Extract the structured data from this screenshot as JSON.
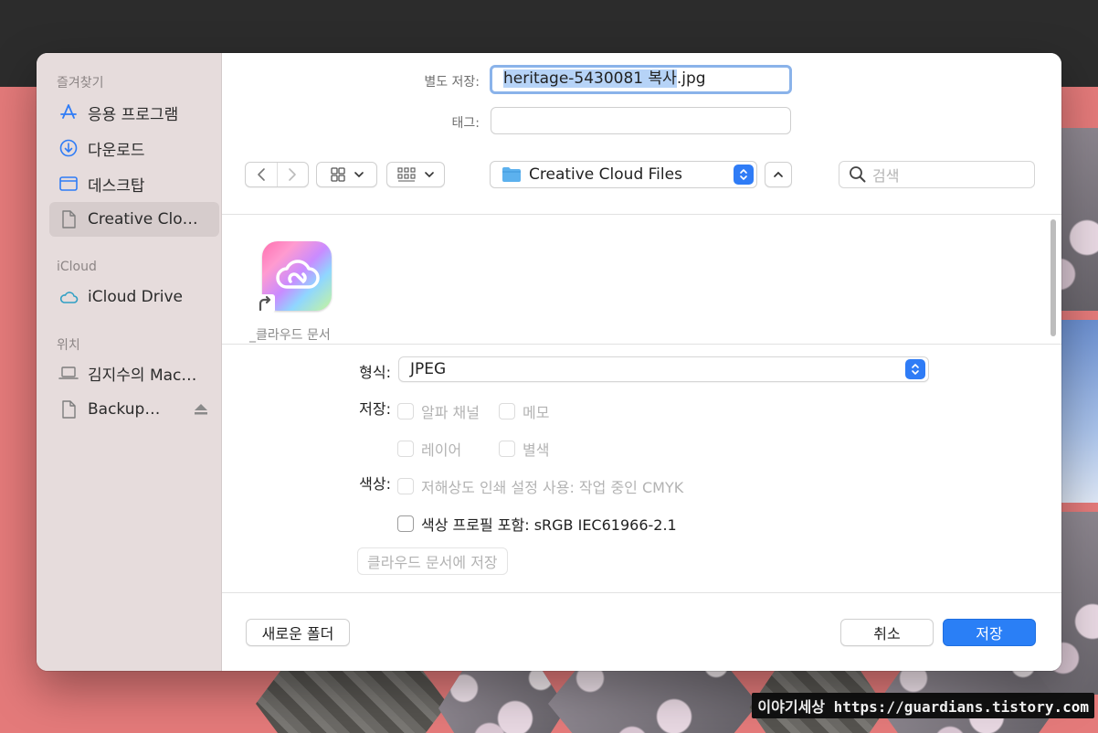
{
  "background": {
    "watermark": "이야기세상 https://guardians.tistory.com"
  },
  "sidebar": {
    "favorites_header": "즐겨찾기",
    "favorites": [
      {
        "label": "응용 프로그램",
        "icon": "applications-icon"
      },
      {
        "label": "다운로드",
        "icon": "download-icon"
      },
      {
        "label": "데스크탑",
        "icon": "desktop-icon"
      },
      {
        "label": "Creative Clo…",
        "icon": "document-icon",
        "selected": true
      }
    ],
    "icloud_header": "iCloud",
    "icloud": [
      {
        "label": "iCloud Drive",
        "icon": "cloud-icon"
      }
    ],
    "locations_header": "위치",
    "locations": [
      {
        "label": "김지수의 Mac…",
        "icon": "laptop-icon"
      },
      {
        "label": "Backup…",
        "icon": "document-icon",
        "eject": true
      }
    ]
  },
  "save": {
    "save_as_label": "별도 저장:",
    "filename_selected": "heritage-5430081 복사",
    "filename_ext": ".jpg",
    "tags_label": "태그:",
    "tags_value": ""
  },
  "toolbar": {
    "location": "Creative Cloud Files",
    "search_placeholder": "검색"
  },
  "files": [
    {
      "name": "_클라우드 문서",
      "icon": "creative-cloud-icon"
    }
  ],
  "options": {
    "format_label": "형식:",
    "format_value": "JPEG",
    "save_label": "저장:",
    "alpha_channel": "알파 채널",
    "memo": "메모",
    "layer": "레이어",
    "spot_color": "별색",
    "color_label": "색상:",
    "soft_proof": "저해상도 인쇄 설정 사용: 작업 중인 CMYK",
    "embed_profile": "색상 프로필 포함: sRGB IEC61966-2.1",
    "save_to_cloud": "클라우드 문서에 저장"
  },
  "footer": {
    "new_folder": "새로운 폴더",
    "cancel": "취소",
    "save": "저장"
  },
  "colors": {
    "accent": "#2a7ff6",
    "sidebar_bg": "#e6dcdc",
    "backdrop": "#e47a7a"
  }
}
